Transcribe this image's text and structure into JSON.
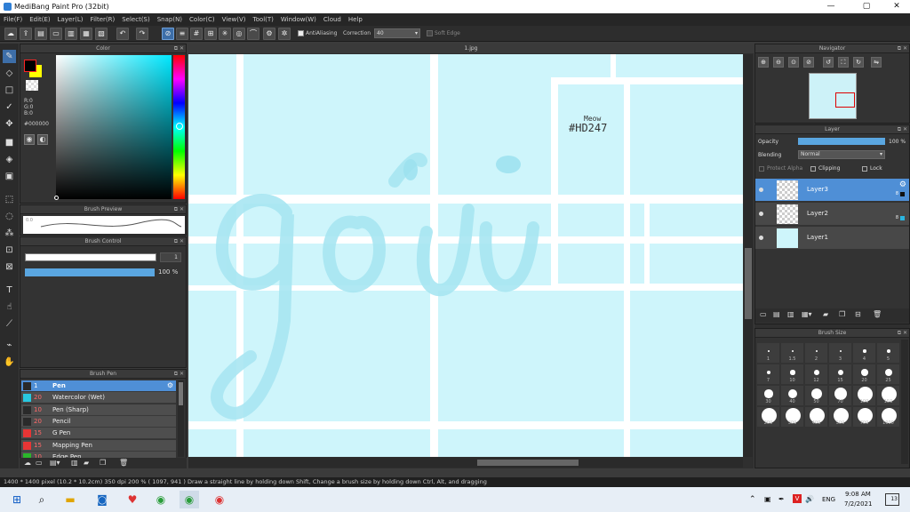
{
  "window": {
    "title": "MediBang Paint Pro (32bit)",
    "minimize": "—",
    "maximize": "▢",
    "close": "✕"
  },
  "menu": [
    "File(F)",
    "Edit(E)",
    "Layer(L)",
    "Filter(R)",
    "Select(S)",
    "Snap(N)",
    "Color(C)",
    "View(V)",
    "Tool(T)",
    "Window(W)",
    "Cloud",
    "Help"
  ],
  "toolbar": {
    "antialias_label": "AntiAliasing",
    "correction_label": "Correction",
    "correction_value": "40",
    "soft_edge_label": "Soft Edge"
  },
  "panels": {
    "color": "Color",
    "brush_preview": "Brush Preview",
    "brush_control": "Brush Control",
    "brush": "Brush Pen",
    "navigator": "Navigator",
    "layer": "Layer",
    "brush_size": "Brush Size"
  },
  "color": {
    "r": "R:0",
    "g": "G:0",
    "b": "B:0",
    "hex": "#000000",
    "preview_value": "0.0"
  },
  "brush_control": {
    "size": "1",
    "opacity": "100 %"
  },
  "brushes": [
    {
      "size": "1",
      "name": "Pen",
      "color": "#2a2a2a",
      "selected": true
    },
    {
      "size": "20",
      "name": "Watercolor (Wet)",
      "color": "#28c8e0"
    },
    {
      "size": "10",
      "name": "Pen (Sharp)",
      "color": "#2a2a2a"
    },
    {
      "size": "20",
      "name": "Pencil",
      "color": "#2a2a2a"
    },
    {
      "size": "15",
      "name": "G Pen",
      "color": "#e83535"
    },
    {
      "size": "15",
      "name": "Mapping Pen",
      "color": "#e83535"
    },
    {
      "size": "10",
      "name": "Edge Pen",
      "color": "#2ab82a"
    }
  ],
  "canvas": {
    "tab": "1.jpg",
    "watermark_line1": "Meow",
    "watermark_line2": "#HD247",
    "lettering": "gởi"
  },
  "layer": {
    "opacity_label": "Opacity",
    "opacity_value": "100 %",
    "blending_label": "Blending",
    "blending_value": "Normal",
    "protect_alpha": "Protect Alpha",
    "clipping": "Clipping",
    "lock": "Lock",
    "items": [
      {
        "name": "Layer3",
        "selected": true,
        "badge": "8"
      },
      {
        "name": "Layer2",
        "selected": false,
        "badge": "8"
      },
      {
        "name": "Layer1",
        "selected": false,
        "badge": ""
      }
    ]
  },
  "brush_sizes": [
    [
      "1",
      "1.5",
      "2",
      "3",
      "4",
      "5"
    ],
    [
      "7",
      "10",
      "12",
      "15",
      "20",
      "25"
    ],
    [
      "30",
      "40",
      "50",
      "70",
      "100",
      "150"
    ],
    [
      "200",
      "300",
      "400",
      "500",
      "700",
      "1000"
    ]
  ],
  "status": {
    "text": "1400 * 1400 pixel  (10.2 * 10.2cm)  350 dpi  200 %  ( 1097, 941 )  Draw a straight line by holding down Shift, Change a brush size by holding down Ctrl, Alt, and dragging"
  },
  "taskbar": {
    "lang": "ENG",
    "time": "9:08 AM",
    "date": "7/2/2021",
    "notifications": "13"
  }
}
